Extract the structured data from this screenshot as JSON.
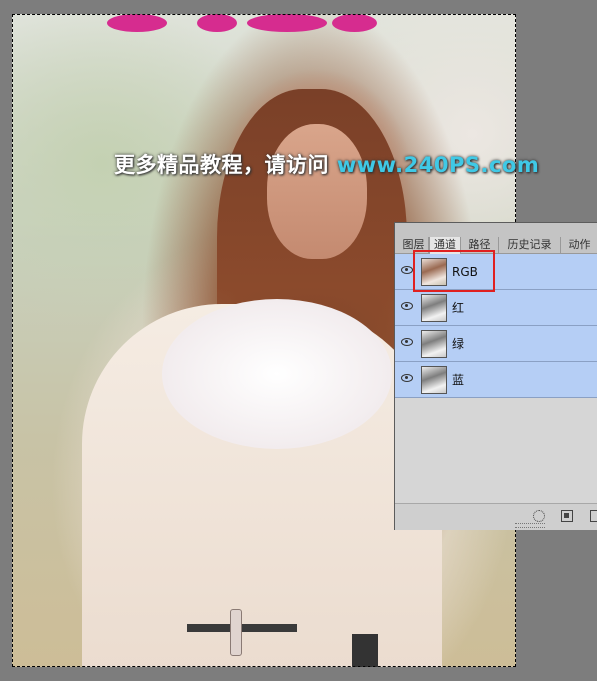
{
  "watermark": {
    "text": "更多精品教程，请访问",
    "url": "www.240PS.com"
  },
  "panel": {
    "tabs": [
      {
        "label": "图层",
        "active": false
      },
      {
        "label": "通道",
        "active": true
      },
      {
        "label": "路径",
        "active": false
      },
      {
        "label": "历史记录",
        "active": false
      },
      {
        "label": "动作",
        "active": false
      }
    ],
    "channels": [
      {
        "name": "RGB",
        "visible": true,
        "thumb": "color"
      },
      {
        "name": "红",
        "visible": true,
        "thumb": "gray"
      },
      {
        "name": "绿",
        "visible": true,
        "thumb": "gray"
      },
      {
        "name": "蓝",
        "visible": true,
        "thumb": "gray"
      }
    ],
    "selected_color": "#b5cef5",
    "highlight_color": "#e02020"
  },
  "icons": {
    "eye": "eye-icon",
    "load_selection": "load-selection-icon",
    "save_selection": "save-selection-icon",
    "new_channel": "new-channel-icon"
  }
}
